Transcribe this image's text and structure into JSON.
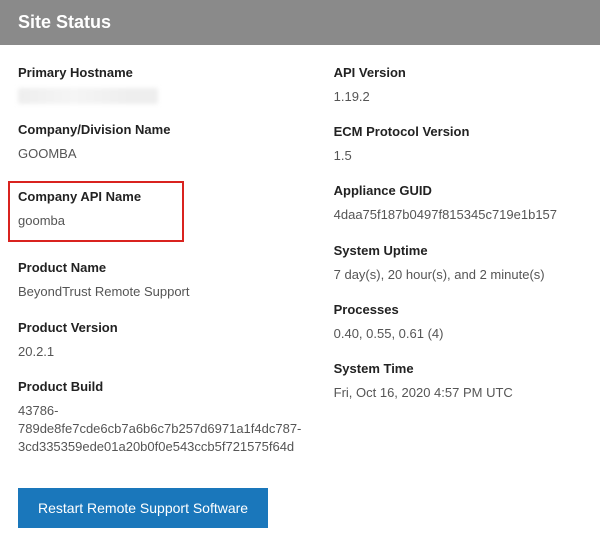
{
  "header": {
    "title": "Site Status"
  },
  "left": {
    "primary_hostname": {
      "label": "Primary Hostname",
      "value": ""
    },
    "company_division": {
      "label": "Company/Division Name",
      "value": "GOOMBA"
    },
    "company_api": {
      "label": "Company API Name",
      "value": "goomba"
    },
    "product_name": {
      "label": "Product Name",
      "value": "BeyondTrust Remote Support"
    },
    "product_version": {
      "label": "Product Version",
      "value": "20.2.1"
    },
    "product_build": {
      "label": "Product Build",
      "value": "43786-789de8fe7cde6cb7a6b6c7b257d6971a1f4dc787-3cd335359ede01a20b0f0e543ccb5f721575f64d"
    }
  },
  "right": {
    "api_version": {
      "label": "API Version",
      "value": "1.19.2"
    },
    "ecm_protocol": {
      "label": "ECM Protocol Version",
      "value": "1.5"
    },
    "appliance_guid": {
      "label": "Appliance GUID",
      "value": "4daa75f187b0497f815345c719e1b157"
    },
    "system_uptime": {
      "label": "System Uptime",
      "value": "7 day(s), 20 hour(s), and 2 minute(s)"
    },
    "processes": {
      "label": "Processes",
      "value": "0.40, 0.55, 0.61 (4)"
    },
    "system_time": {
      "label": "System Time",
      "value": "Fri, Oct 16, 2020 4:57 PM UTC"
    }
  },
  "actions": {
    "restart_label": "Restart Remote Support Software"
  }
}
